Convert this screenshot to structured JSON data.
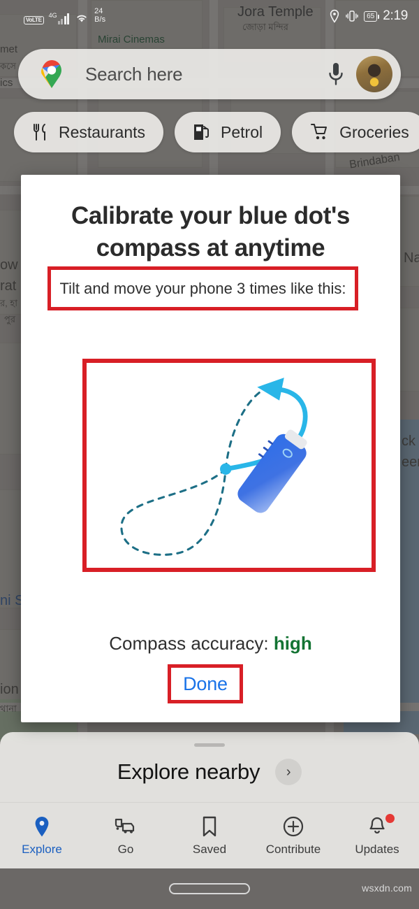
{
  "status_bar": {
    "volte": "VoLTE",
    "network": "4G",
    "data_rate_value": "24",
    "data_rate_unit": "B/s",
    "battery": "65",
    "time": "2:19",
    "icons": [
      "wifi-icon",
      "location-pin-icon",
      "vibrate-icon",
      "battery-icon"
    ]
  },
  "search": {
    "placeholder": "Search here",
    "logo": "google-maps-pin-icon",
    "mic": "microphone-icon",
    "avatar": "profile-avatar"
  },
  "chips": [
    {
      "label": "Restaurants",
      "icon": "restaurant-icon"
    },
    {
      "label": "Petrol",
      "icon": "fuel-pump-icon"
    },
    {
      "label": "Groceries",
      "icon": "shopping-cart-icon"
    }
  ],
  "map_labels": [
    {
      "text": "Mirai Cinemas",
      "kind": "poi"
    },
    {
      "text": "Jora Temple",
      "kind": "plain"
    },
    {
      "text": "জোড়া মন্দির",
      "kind": "bn"
    },
    {
      "text": "Brindaban",
      "kind": "plain"
    },
    {
      "text": "met",
      "kind": "plain"
    },
    {
      "text": "কসে",
      "kind": "bn"
    },
    {
      "text": "ics",
      "kind": "plain"
    },
    {
      "text": "ow",
      "kind": "plain"
    },
    {
      "text": "rat",
      "kind": "plain"
    },
    {
      "text": "র, হা",
      "kind": "bn"
    },
    {
      "text": "পুর",
      "kind": "bn"
    },
    {
      "text": "ni S",
      "kind": "blue"
    },
    {
      "text": "ion",
      "kind": "plain"
    },
    {
      "text": "থানা",
      "kind": "bn"
    },
    {
      "text": "Na",
      "kind": "plain"
    },
    {
      "text": "ck a",
      "kind": "plain"
    },
    {
      "text": "eers",
      "kind": "plain"
    }
  ],
  "dialog": {
    "title": "Calibrate your blue dot's compass at anytime",
    "subtitle": "Tilt and move your phone 3 times like this:",
    "animation": "figure-eight-phone-calibration-illustration",
    "accuracy_label": "Compass accuracy:",
    "accuracy_value": "high",
    "done_label": "Done",
    "colors": {
      "annotation_box": "#d81f26",
      "accuracy_high": "#137333",
      "done_text": "#1a73e8",
      "path": "#29b6e8",
      "phone": "#3b6fe0"
    }
  },
  "explore_sheet": {
    "label": "Explore nearby",
    "chevron": "chevron-right-icon"
  },
  "bottom_nav": [
    {
      "label": "Explore",
      "icon": "location-pin-icon",
      "active": true,
      "badge": false
    },
    {
      "label": "Go",
      "icon": "commute-icon",
      "active": false,
      "badge": false
    },
    {
      "label": "Saved",
      "icon": "bookmark-icon",
      "active": false,
      "badge": false
    },
    {
      "label": "Contribute",
      "icon": "plus-circle-icon",
      "active": false,
      "badge": false
    },
    {
      "label": "Updates",
      "icon": "bell-icon",
      "active": false,
      "badge": true
    }
  ],
  "watermark": "wsxdn.com"
}
